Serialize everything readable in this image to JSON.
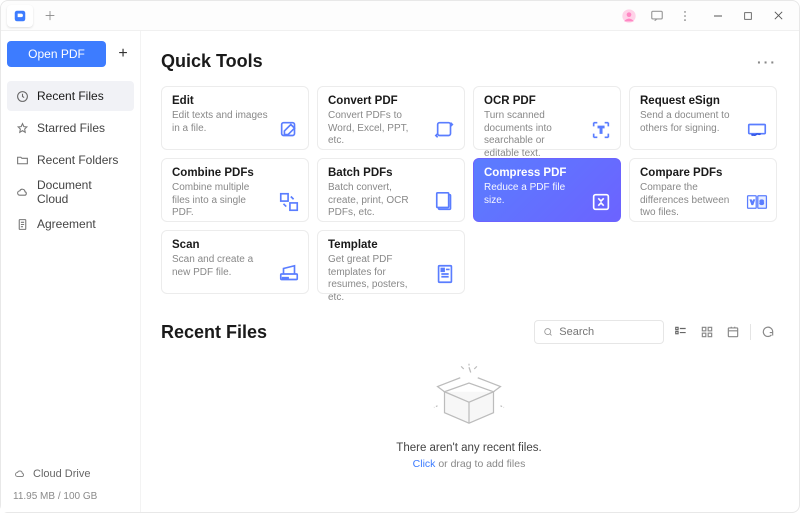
{
  "titlebar": {
    "logo_color": "#3d7cff"
  },
  "sidebar": {
    "open_label": "Open PDF",
    "items": [
      {
        "label": "Recent Files",
        "icon": "clock",
        "active": true
      },
      {
        "label": "Starred Files",
        "icon": "star",
        "active": false
      },
      {
        "label": "Recent Folders",
        "icon": "folder",
        "active": false
      },
      {
        "label": "Document Cloud",
        "icon": "cloud",
        "active": false
      },
      {
        "label": "Agreement",
        "icon": "doc",
        "active": false
      }
    ],
    "cloud_drive_label": "Cloud Drive",
    "quota": "11.95 MB / 100 GB"
  },
  "quick_tools": {
    "heading": "Quick Tools",
    "cards": [
      {
        "title": "Edit",
        "desc": "Edit texts and images in a file."
      },
      {
        "title": "Convert PDF",
        "desc": "Convert PDFs to Word, Excel, PPT, etc."
      },
      {
        "title": "OCR PDF",
        "desc": "Turn scanned documents into searchable or editable text."
      },
      {
        "title": "Request eSign",
        "desc": "Send a document to others for signing."
      },
      {
        "title": "Combine PDFs",
        "desc": "Combine multiple files into a single PDF."
      },
      {
        "title": "Batch PDFs",
        "desc": "Batch convert, create, print, OCR PDFs, etc."
      },
      {
        "title": "Compress PDF",
        "desc": "Reduce a PDF file size."
      },
      {
        "title": "Compare PDFs",
        "desc": "Compare the differences between two files."
      },
      {
        "title": "Scan",
        "desc": "Scan and create a new PDF file."
      },
      {
        "title": "Template",
        "desc": "Get great PDF templates for resumes, posters, etc."
      }
    ]
  },
  "recent": {
    "heading": "Recent Files",
    "search_placeholder": "Search",
    "empty_title": "There aren't any recent files.",
    "click_text": "Click",
    "or_drag_text": " or drag ",
    "add_text": "to add files"
  }
}
